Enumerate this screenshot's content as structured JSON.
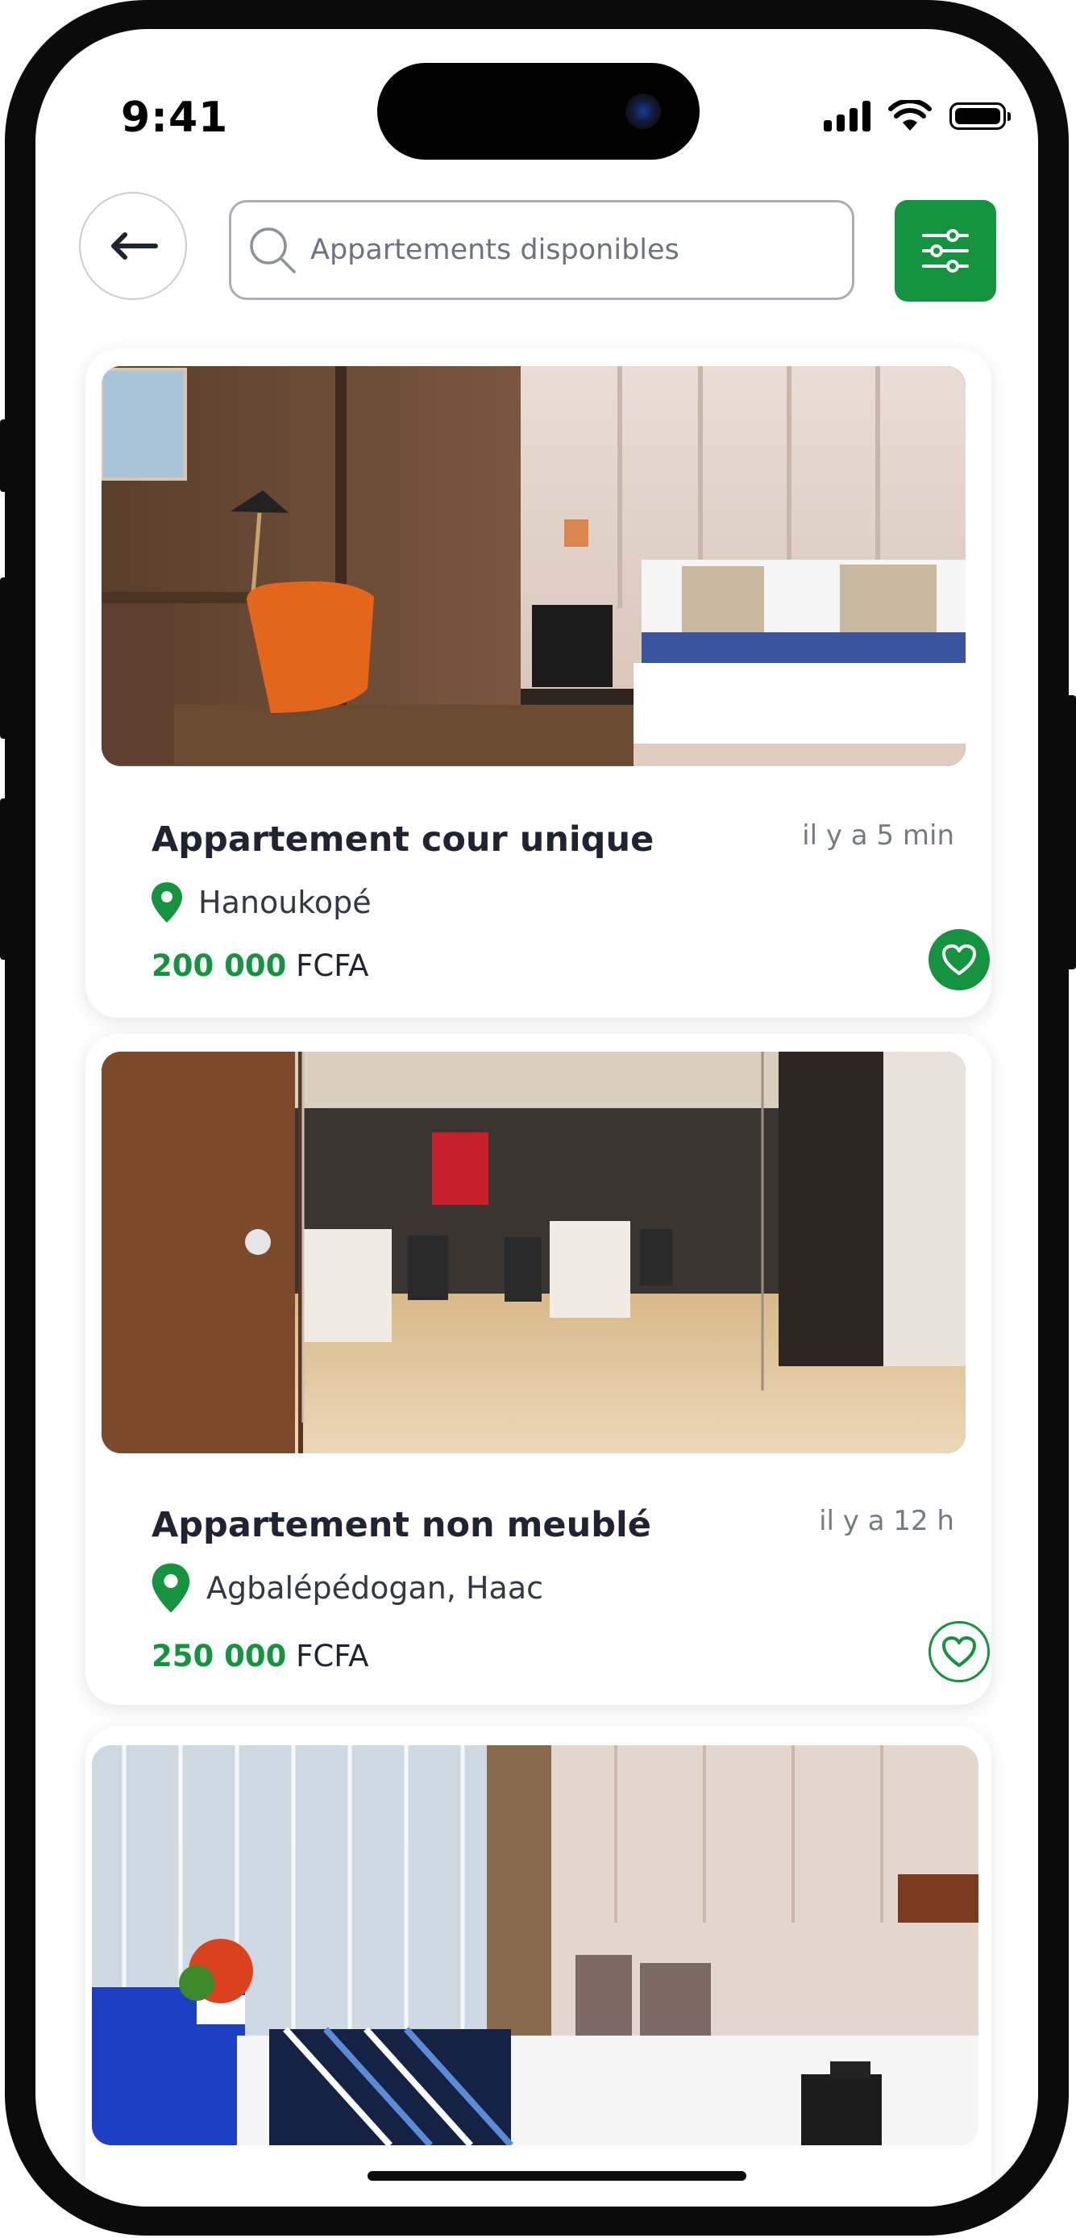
{
  "status_bar": {
    "time": "9:41"
  },
  "header": {
    "back_label": "back",
    "search_placeholder": "Appartements disponibles",
    "filter_label": "filters"
  },
  "colors": {
    "accent": "#14943f",
    "text_dark": "#1f2433",
    "text_muted": "#737b86"
  },
  "listings": [
    {
      "title": "Appartement cour unique",
      "time": "il y a 5 min",
      "location": "Hanoukopé",
      "price_amount": "200 000",
      "currency": "FCFA",
      "favorite": true,
      "image": "hotel room with wooden desk, orange armchair and double bed"
    },
    {
      "title": "Appartement non meublé",
      "time": "il y a 12 h",
      "location": "Agbalépédogan, Haac",
      "price_amount": "250 000",
      "currency": "FCFA",
      "favorite": false,
      "image": "office space with glass partition and desks"
    },
    {
      "image": "bedroom with large window, curtains and striped bed runner"
    }
  ]
}
